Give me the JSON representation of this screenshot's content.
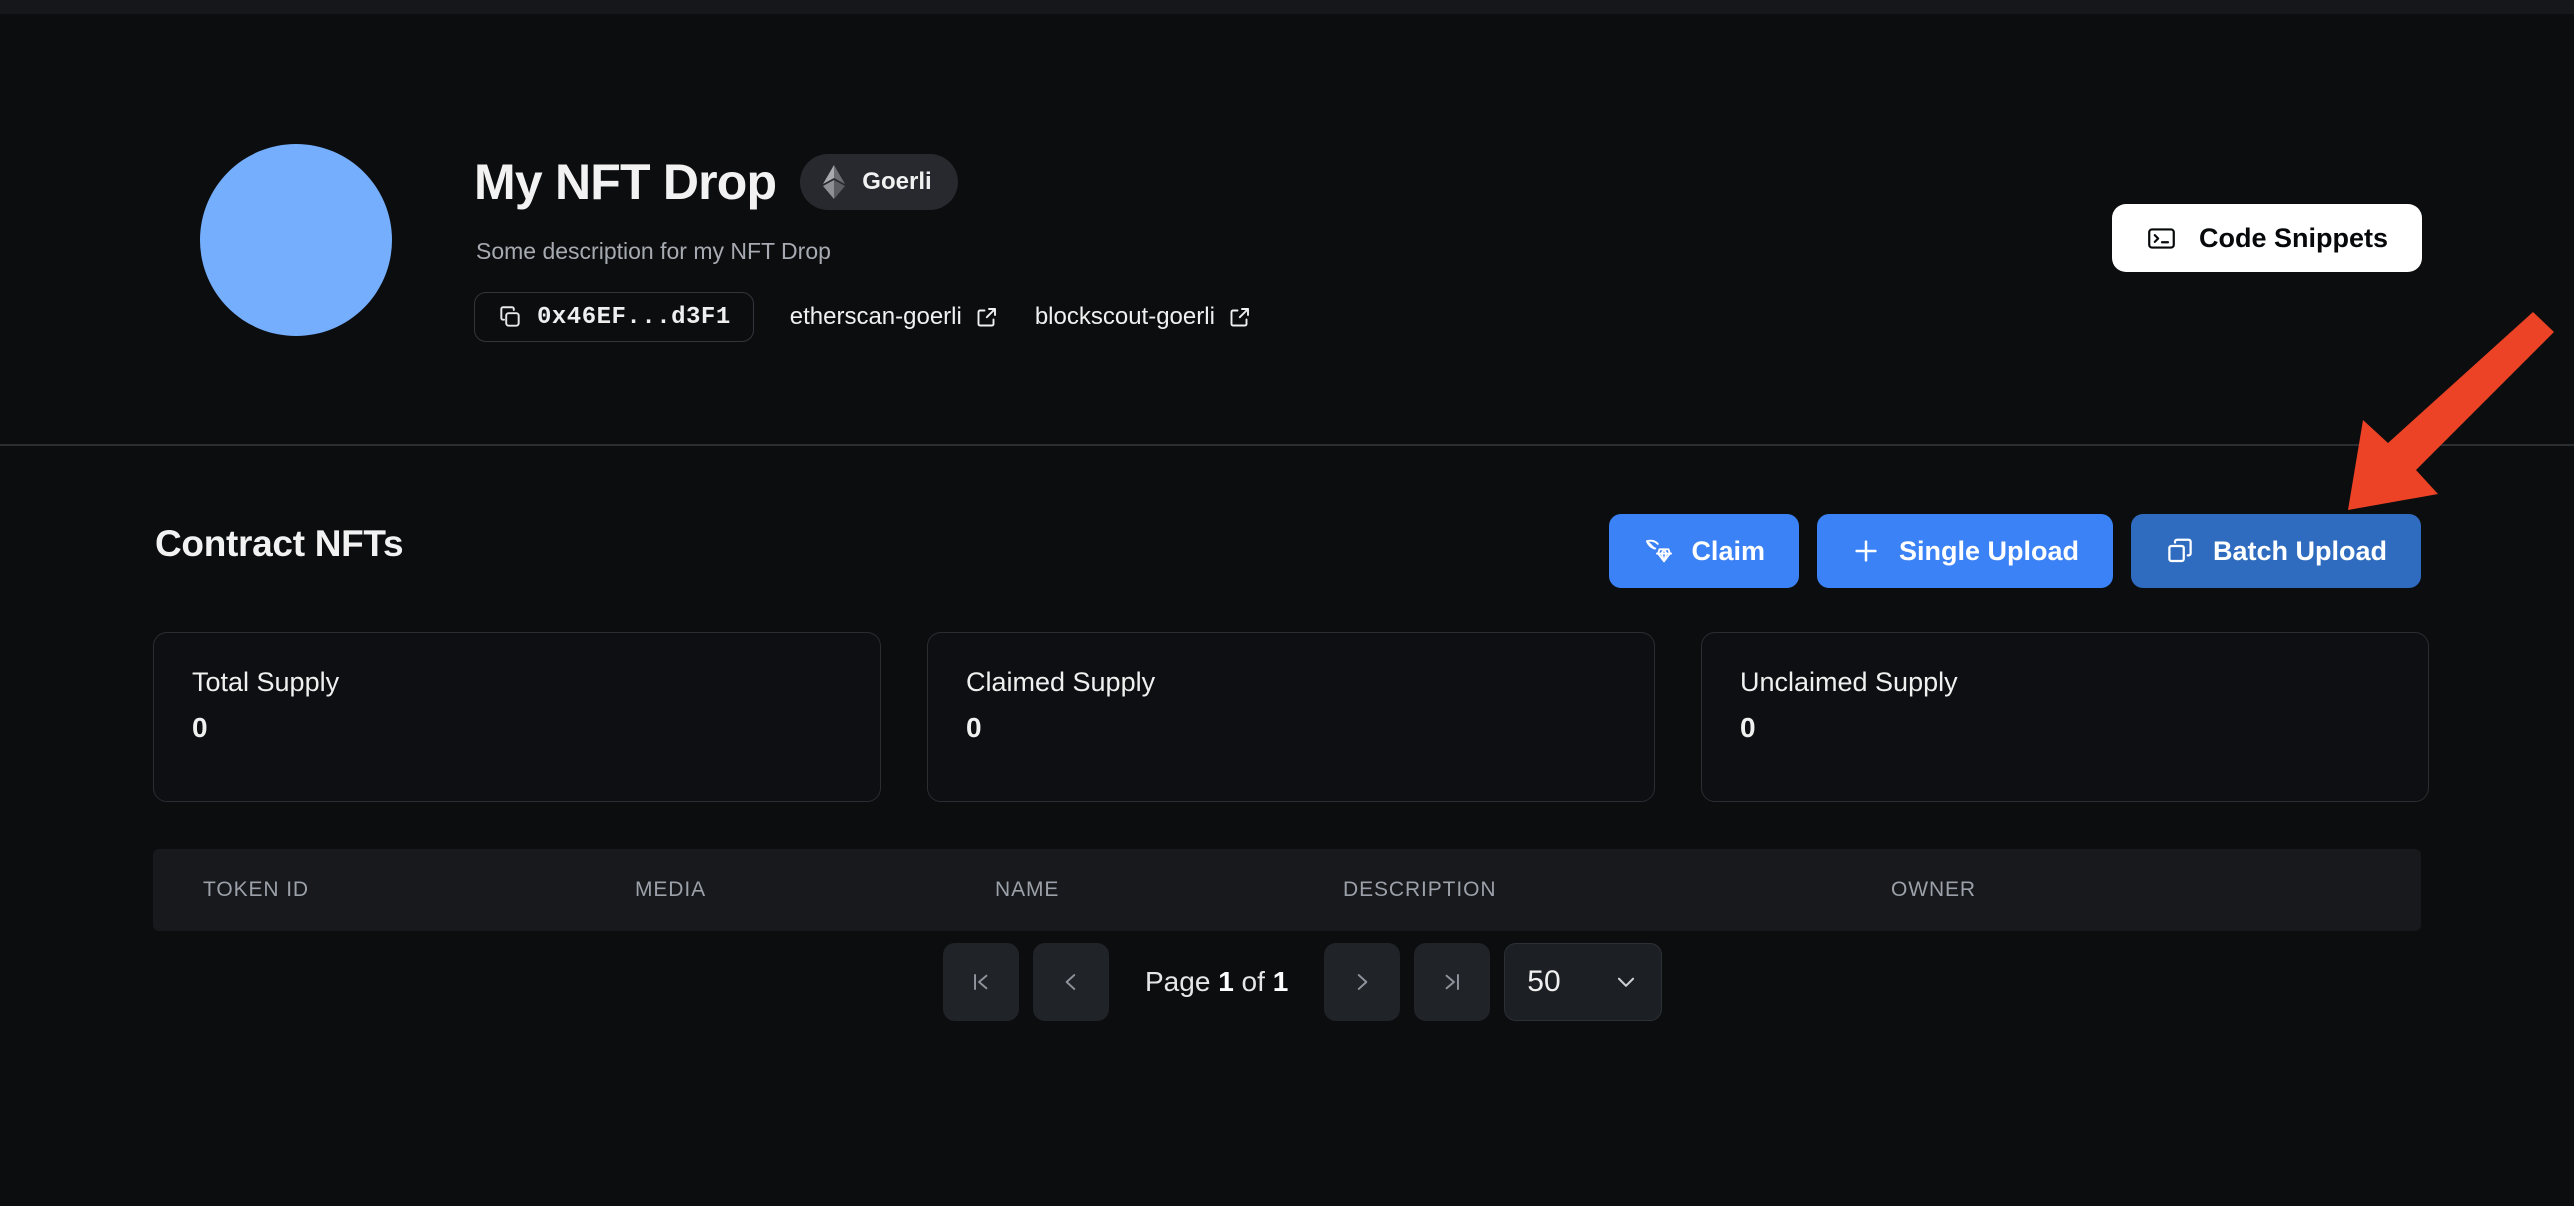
{
  "header": {
    "avatar": "contract-avatar",
    "title": "My NFT Drop",
    "chain": {
      "label": "Goerli",
      "icon": "ethereum-icon"
    },
    "description": "Some description for my NFT Drop",
    "address": {
      "value": "0x46EF...d3F1",
      "icon": "copy-icon"
    },
    "links": [
      {
        "label": "etherscan-goerli",
        "icon": "external-link-icon"
      },
      {
        "label": "blockscout-goerli",
        "icon": "external-link-icon"
      }
    ],
    "code_snippets": {
      "label": "Code Snippets",
      "icon": "terminal-icon"
    }
  },
  "main": {
    "section_title": "Contract NFTs",
    "actions": [
      {
        "label": "Claim",
        "icon": "pickaxe-gem-icon",
        "state": "default"
      },
      {
        "label": "Single Upload",
        "icon": "plus-icon",
        "state": "default"
      },
      {
        "label": "Batch Upload",
        "icon": "layers-copy-icon",
        "state": "active"
      }
    ],
    "stats": [
      {
        "label": "Total Supply",
        "value": "0"
      },
      {
        "label": "Claimed Supply",
        "value": "0"
      },
      {
        "label": "Unclaimed Supply",
        "value": "0"
      }
    ],
    "table": {
      "columns": [
        "TOKEN ID",
        "MEDIA",
        "NAME",
        "DESCRIPTION",
        "OWNER"
      ],
      "rows": []
    },
    "pagination": {
      "first": "|<",
      "prev": "‹",
      "next": "›",
      "last": ">|",
      "page_prefix": "Page",
      "page_current": "1",
      "page_joiner": "of",
      "page_total": "1",
      "page_size": "50",
      "page_size_icon": "chevron-down-icon"
    }
  },
  "annotation": {
    "arrow": "red-arrow-pointing-to-batch-upload",
    "color": "#ec4226"
  },
  "colors": {
    "background": "#0c0d0f",
    "accent_blue": "#3b82f6",
    "accent_blue_active": "#2f6cc0",
    "avatar_blue": "#74aefc",
    "annotation_red": "#ec4226"
  }
}
